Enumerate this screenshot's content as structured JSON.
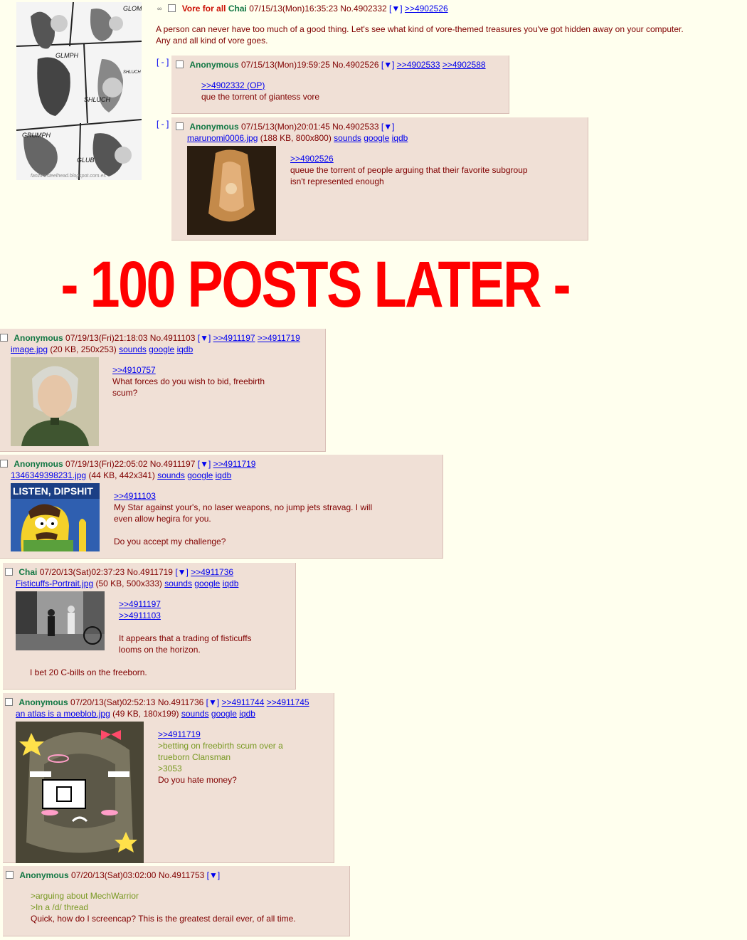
{
  "op": {
    "subject": "Vore for all",
    "name": "Chai",
    "date": "07/15/13(Mon)16:35:23",
    "no": "No.4902332",
    "menu": "[▼]",
    "backlinks": [
      ">>4902526"
    ],
    "message": [
      "A person can never have too much of a good thing. Let's see what kind of vore-themed treasures you've got hidden away on your computer.",
      "Any and all kind of vore goes."
    ],
    "thumb_words": [
      "GLOMP",
      "GLMPH",
      "SHLUCH",
      "GRUMPH",
      "GLUB",
      "SHLUCH"
    ],
    "thumb_credit": "fanzinesteelhead.blogspot.com.es"
  },
  "expand_label": "[ - ]",
  "replies": [
    {
      "name": "Anonymous",
      "date": "07/15/13(Mon)19:59:25",
      "no": "No.4902526",
      "menu": "[▼]",
      "backlinks": [
        ">>4902533",
        ">>4902588"
      ],
      "quotelink": ">>4902332 (OP)",
      "message": [
        "que the torrent of giantess vore"
      ]
    },
    {
      "name": "Anonymous",
      "date": "07/15/13(Mon)20:01:45",
      "no": "No.4902533",
      "menu": "[▼]",
      "file": {
        "name": "marunomi0006.jpg",
        "info": "(188 KB, 800x800)",
        "links": [
          "sounds",
          "google",
          "iqdb"
        ]
      },
      "quotelink": ">>4902526",
      "message": [
        "queue the torrent of people arguing that their favorite subgroup",
        "isn't represented enough"
      ]
    }
  ],
  "banner": "- 100 POSTS LATER -",
  "later_posts": [
    {
      "name": "Anonymous",
      "date": "07/19/13(Fri)21:18:03",
      "no": "No.4911103",
      "menu": "[▼]",
      "backlinks": [
        ">>4911197",
        ">>4911719"
      ],
      "file": {
        "name": "image.jpg",
        "info": "(20 KB, 250x253)",
        "links": [
          "sounds",
          "google",
          "iqdb"
        ]
      },
      "quotelink": ">>4910757",
      "message": [
        "What forces do you wish to bid, freebirth",
        "scum?"
      ]
    },
    {
      "name": "Anonymous",
      "date": "07/19/13(Fri)22:05:02",
      "no": "No.4911197",
      "menu": "[▼]",
      "backlinks": [
        ">>4911719"
      ],
      "file": {
        "name": "1346349398231.jpg",
        "info": "(44 KB, 442x341)",
        "links": [
          "sounds",
          "google",
          "iqdb"
        ]
      },
      "thumb_caption": "LISTEN, DIPSHIT",
      "quotelink": ">>4911103",
      "message": [
        "My Star against your's, no laser weapons, no jump jets stravag. I will",
        "even allow hegira for you.",
        "",
        "Do you accept my challenge?"
      ]
    },
    {
      "name": "Chai",
      "date": "07/20/13(Sat)02:37:23",
      "no": "No.4911719",
      "menu": "[▼]",
      "backlinks": [
        ">>4911736"
      ],
      "file": {
        "name": "Fisticuffs-Portrait.jpg",
        "info": "(50 KB, 500x333)",
        "links": [
          "sounds",
          "google",
          "iqdb"
        ]
      },
      "quotelinks": [
        ">>4911197",
        ">>4911103"
      ],
      "message": [
        "It appears that a trading of fisticuffs",
        "looms on the horizon."
      ],
      "message2": "I bet 20 C-bills on the freeborn."
    },
    {
      "name": "Anonymous",
      "date": "07/20/13(Sat)02:52:13",
      "no": "No.4911736",
      "menu": "[▼]",
      "backlinks": [
        ">>4911744",
        ">>4911745"
      ],
      "file": {
        "name": "an atlas is a moeblob.jpg",
        "info": "(49 KB, 180x199)",
        "links": [
          "sounds",
          "google",
          "iqdb"
        ]
      },
      "quotelink": ">>4911719",
      "greentext": [
        ">betting on freebirth scum over a",
        "trueborn Clansman",
        ">3053"
      ],
      "message": [
        "Do you hate money?"
      ]
    },
    {
      "name": "Anonymous",
      "date": "07/20/13(Sat)03:02:00",
      "no": "No.4911753",
      "menu": "[▼]",
      "greentext": [
        ">arguing about MechWarrior",
        ">In a /d/ thread"
      ],
      "message": [
        "Quick, how do I screencap? This is the greatest derail ever, of all time."
      ]
    }
  ]
}
